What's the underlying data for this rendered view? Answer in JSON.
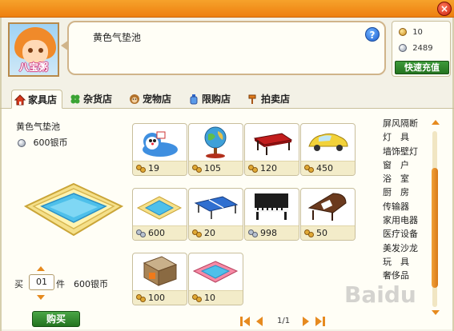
{
  "window": {
    "close_label": "×"
  },
  "avatar": {
    "name": "八宝粥"
  },
  "bubble": {
    "text": "黄色气垫池",
    "help_label": "?"
  },
  "currency": {
    "gold": "10",
    "silver": "2489",
    "recharge_label": "快速充值"
  },
  "tabs": [
    {
      "label": "家具店",
      "icon": "house-icon",
      "active": true
    },
    {
      "label": "杂货店",
      "icon": "clover-icon",
      "active": false
    },
    {
      "label": "宠物店",
      "icon": "monkey-icon",
      "active": false
    },
    {
      "label": "限购店",
      "icon": "bottle-icon",
      "active": false
    },
    {
      "label": "拍卖店",
      "icon": "gavel-icon",
      "active": false
    }
  ],
  "selected": {
    "name": "黄色气垫池",
    "price": "600银币"
  },
  "purchase": {
    "qty_label": "买",
    "qty_value": "01",
    "unit": "件",
    "total": "600银币",
    "buy_label": "购买"
  },
  "items": [
    {
      "name": "doraemon-toy",
      "price": "19",
      "currency": "gold"
    },
    {
      "name": "globe",
      "price": "105",
      "currency": "gold"
    },
    {
      "name": "red-table",
      "price": "120",
      "currency": "gold"
    },
    {
      "name": "yellow-car",
      "price": "450",
      "currency": "gold"
    },
    {
      "name": "blue-pool",
      "price": "600",
      "currency": "silver"
    },
    {
      "name": "ping-pong-table",
      "price": "20",
      "currency": "gold"
    },
    {
      "name": "black-piano",
      "price": "998",
      "currency": "silver"
    },
    {
      "name": "brown-piano",
      "price": "50",
      "currency": "gold"
    },
    {
      "name": "fireplace",
      "price": "100",
      "currency": "gold"
    },
    {
      "name": "pink-pool",
      "price": "10",
      "currency": "gold"
    }
  ],
  "categories": [
    "屏风隔断",
    "灯　具",
    "墙饰壁灯",
    "窗　户",
    "浴　室",
    "厨　房",
    "传输器",
    "家用电器",
    "医疗设备",
    "美发沙龙",
    "玩　具",
    "奢侈品"
  ],
  "pager": {
    "text": "1/1"
  },
  "watermark": "Baidu"
}
